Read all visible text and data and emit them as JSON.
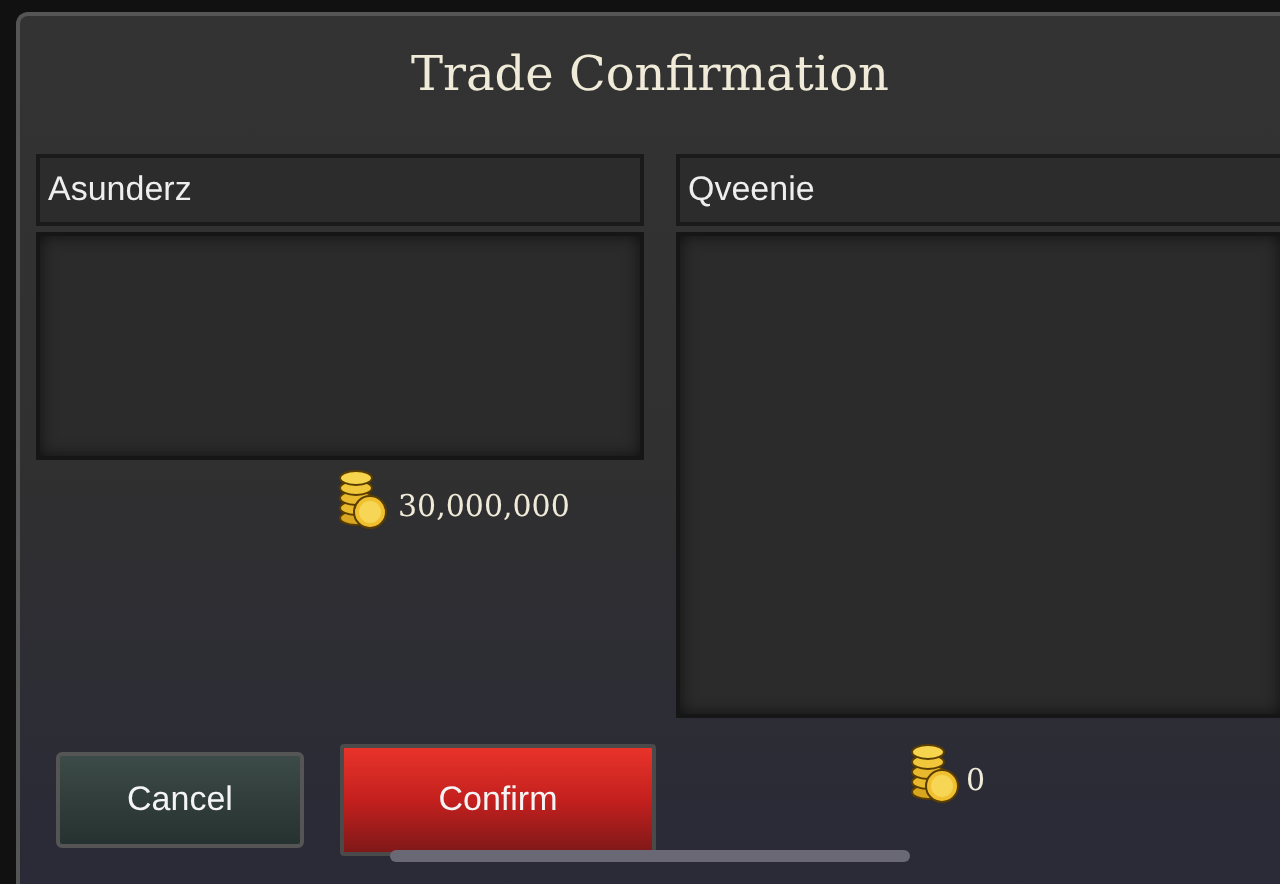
{
  "dialog": {
    "title": "Trade Confirmation"
  },
  "traders": [
    {
      "name": "Asunderz",
      "gold": "30,000,000"
    },
    {
      "name": "Qveenie",
      "gold": "0"
    }
  ],
  "buttons": [
    {
      "label": "Cancel",
      "kind": "cancel"
    },
    {
      "label": "Confirm",
      "kind": "confirm"
    }
  ]
}
